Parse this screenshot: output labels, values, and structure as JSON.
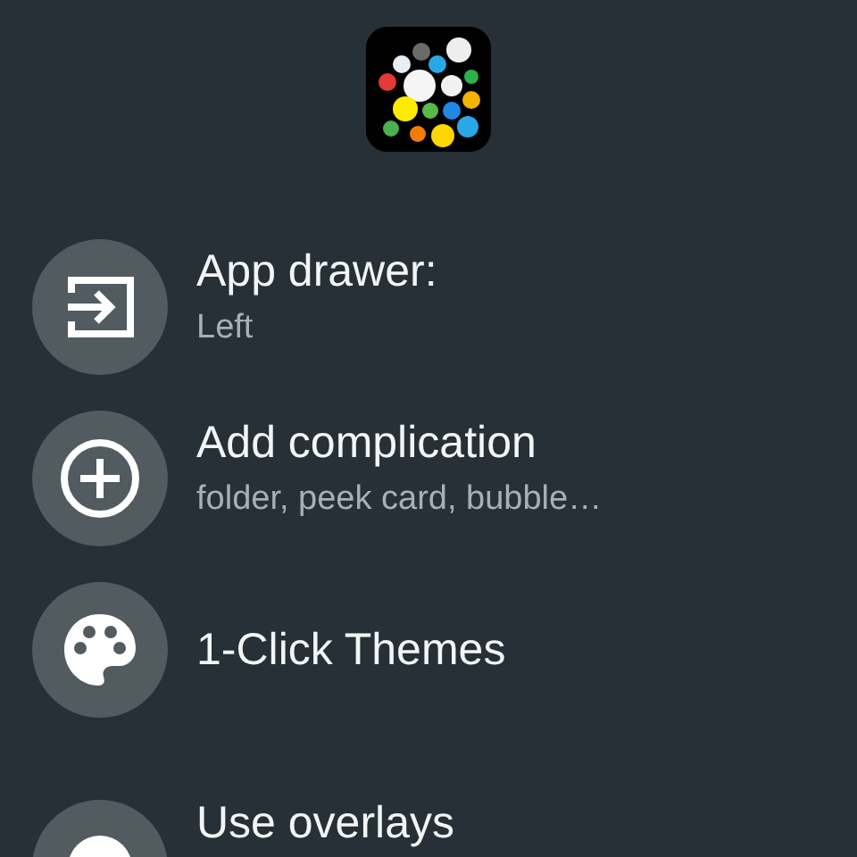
{
  "sections": [
    {
      "items": [
        {
          "kind": "two_line",
          "title": "App drawer:",
          "subtitle": "Left"
        },
        {
          "kind": "two_line",
          "title": "Add complication",
          "subtitle": "folder, peek card, bubble…"
        },
        {
          "kind": "one_line",
          "title": "1-Click Themes"
        }
      ]
    },
    {
      "items": [
        {
          "kind": "two_line",
          "title": "Use overlays"
        }
      ]
    }
  ]
}
